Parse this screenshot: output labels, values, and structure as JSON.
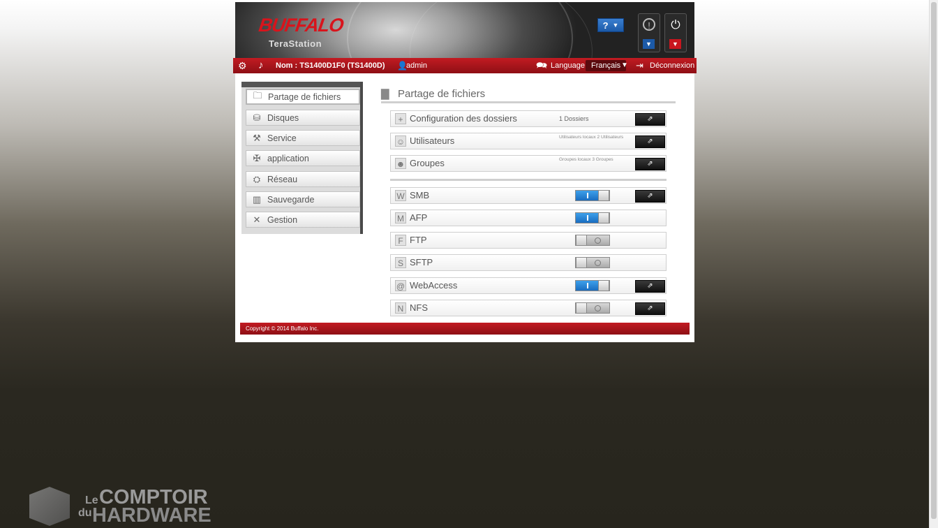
{
  "header": {
    "brand": "BUFFALO",
    "product": "TeraStation",
    "help_label": "?",
    "help_arrow": "▼",
    "info_glyph": "!",
    "power_glyph": "⏻",
    "drop_arrow": "▼"
  },
  "topbar": {
    "device_name": "Nom : TS1400D1F0 (TS1400D)",
    "user": "admin",
    "language_label": "Language",
    "language_value": "Français",
    "logout_label": "Déconnexion"
  },
  "sidebar": {
    "items": [
      {
        "label": "Partage de fichiers",
        "icon": "folder-icon"
      },
      {
        "label": "Disques",
        "icon": "disk-icon"
      },
      {
        "label": "Service",
        "icon": "service-icon"
      },
      {
        "label": "application",
        "icon": "application-icon"
      },
      {
        "label": "Réseau",
        "icon": "network-icon"
      },
      {
        "label": "Sauvegarde",
        "icon": "backup-icon"
      },
      {
        "label": "Gestion",
        "icon": "tools-icon"
      }
    ]
  },
  "main": {
    "title": "Partage de fichiers",
    "rows": [
      {
        "label": "Configuration des dossiers",
        "info": "1 Dossiers",
        "link": true
      },
      {
        "label": "Utilisateurs",
        "info": "Utilisateurs locaux 2 Utilisateurs",
        "link": true
      },
      {
        "label": "Groupes",
        "info": "Groupes locaux 3 Groupes",
        "link": true
      }
    ],
    "services": [
      {
        "label": "SMB",
        "badge": "W",
        "enabled": true,
        "link": true
      },
      {
        "label": "AFP",
        "badge": "M",
        "enabled": true,
        "link": false
      },
      {
        "label": "FTP",
        "badge": "F",
        "enabled": false,
        "link": false
      },
      {
        "label": "SFTP",
        "badge": "S",
        "enabled": false,
        "link": false
      },
      {
        "label": "WebAccess",
        "badge": "@",
        "enabled": true,
        "link": true
      },
      {
        "label": "NFS",
        "badge": "N",
        "enabled": false,
        "link": true
      }
    ],
    "link_glyph": "⇗"
  },
  "footer": {
    "copyright": "Copyright © 2014 Buffalo Inc."
  },
  "watermark": {
    "le": "Le",
    "du": "du",
    "line1": "COMPTOIR",
    "line2": "HARDWARE"
  },
  "colors": {
    "accent_red": "#c21b22",
    "toggle_on": "#1a6dc0"
  }
}
